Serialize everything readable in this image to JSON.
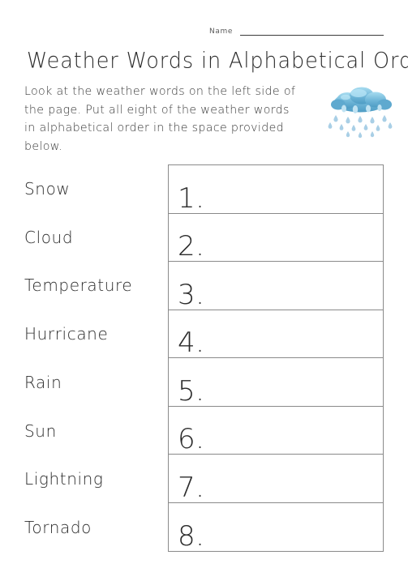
{
  "header": {
    "name_label": "Name",
    "name_value": ""
  },
  "title": "Weather Words in Alphabetical Order",
  "instructions": {
    "line1": "Look at the weather words on the left side of",
    "line2": "the page.  Put all eight of the weather words",
    "line3": "in alphabetical order in the space provided below."
  },
  "artwork": {
    "name": "rain-cloud-illustration",
    "cloud_color": "#6fb6d8",
    "cloud_highlight": "#a8dcf0",
    "cloud_shadow": "#4e9cc4",
    "raindrop_color": "#a9cfe6"
  },
  "words": [
    "Snow",
    "Cloud",
    "Temperature",
    "Hurricane",
    "Rain",
    "Sun",
    "Lightning",
    "Tornado"
  ],
  "answer_rows": [
    {
      "number": "1.",
      "value": ""
    },
    {
      "number": "2.",
      "value": ""
    },
    {
      "number": "3.",
      "value": ""
    },
    {
      "number": "4.",
      "value": ""
    },
    {
      "number": "5.",
      "value": ""
    },
    {
      "number": "6.",
      "value": ""
    },
    {
      "number": "7.",
      "value": ""
    },
    {
      "number": "8.",
      "value": ""
    }
  ],
  "colors": {
    "text": "#2b2b2b",
    "muted_text": "#5a5a5a",
    "border": "#8a8a8a",
    "background": "#ffffff"
  }
}
